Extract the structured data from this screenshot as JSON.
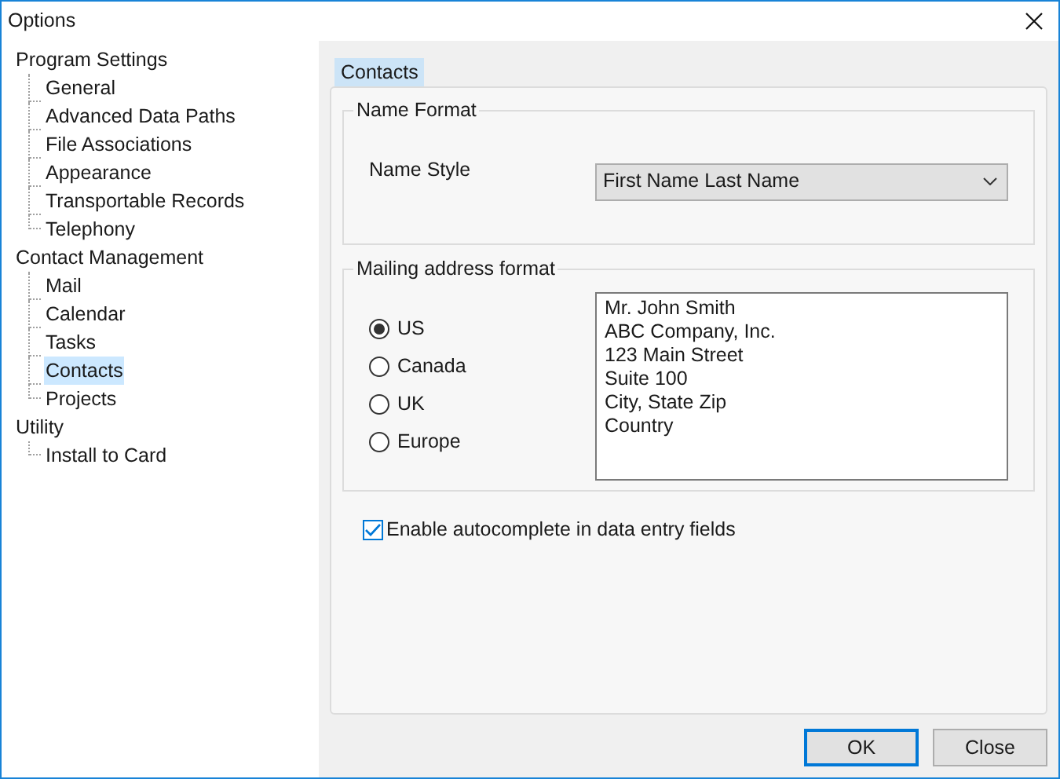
{
  "window": {
    "title": "Options"
  },
  "tree": [
    {
      "label": "Program Settings",
      "selected": false,
      "children": [
        {
          "label": "General",
          "selected": false
        },
        {
          "label": "Advanced Data Paths",
          "selected": false
        },
        {
          "label": "File Associations",
          "selected": false
        },
        {
          "label": "Appearance",
          "selected": false
        },
        {
          "label": "Transportable Records",
          "selected": false
        },
        {
          "label": "Telephony",
          "selected": false
        }
      ]
    },
    {
      "label": "Contact Management",
      "selected": false,
      "children": [
        {
          "label": "Mail",
          "selected": false
        },
        {
          "label": "Calendar",
          "selected": false
        },
        {
          "label": "Tasks",
          "selected": false
        },
        {
          "label": "Contacts",
          "selected": true
        },
        {
          "label": "Projects",
          "selected": false
        }
      ]
    },
    {
      "label": "Utility",
      "selected": false,
      "children": [
        {
          "label": "Install to Card",
          "selected": false
        }
      ]
    }
  ],
  "tab": {
    "label": "Contacts",
    "selected": true
  },
  "name_format": {
    "title": "Name Format",
    "label": "Name Style",
    "value": "First Name Last Name"
  },
  "mailing": {
    "title": "Mailing address format",
    "options": [
      {
        "label": "US",
        "selected": true
      },
      {
        "label": "Canada",
        "selected": false
      },
      {
        "label": "UK",
        "selected": false
      },
      {
        "label": "Europe",
        "selected": false
      }
    ],
    "address": [
      "Mr. John Smith",
      "ABC Company, Inc.",
      "123 Main Street",
      "Suite 100",
      "City, State Zip",
      "Country"
    ]
  },
  "autocomplete": {
    "label": "Enable autocomplete in data entry fields",
    "checked": true
  },
  "buttons": [
    {
      "label": "OK",
      "default": true
    },
    {
      "label": "Close",
      "default": false
    }
  ]
}
